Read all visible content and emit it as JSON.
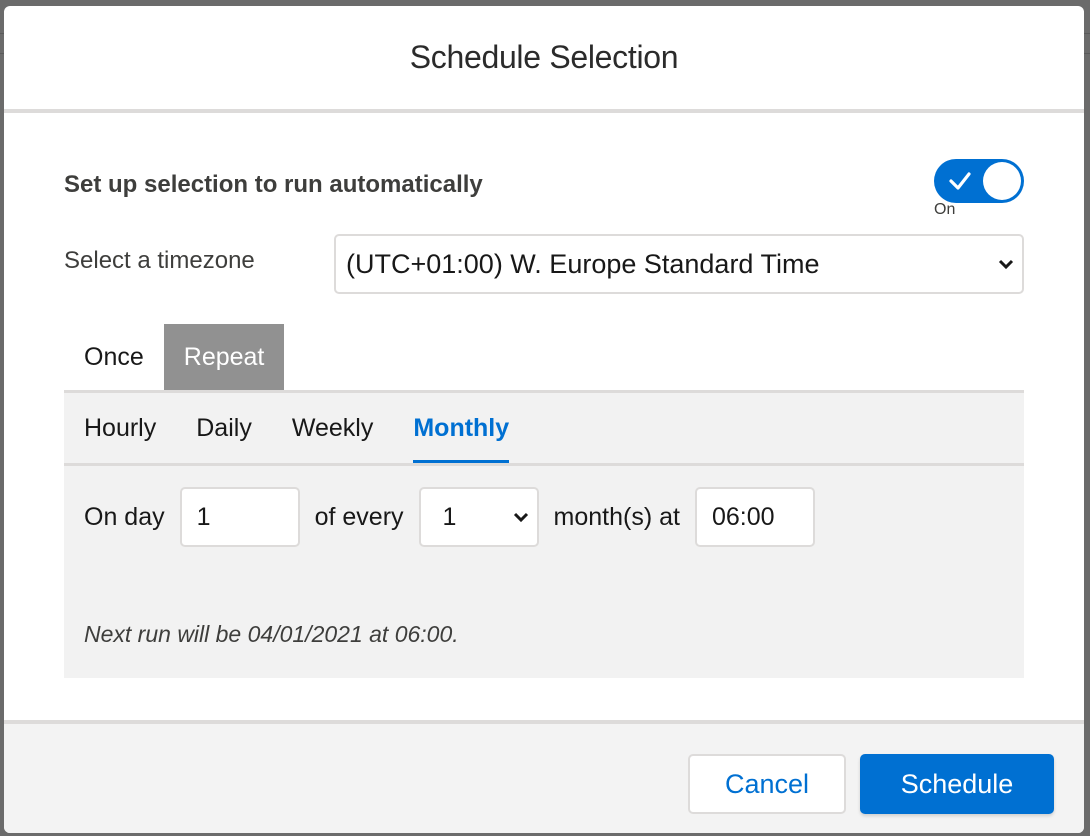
{
  "modal": {
    "title": "Schedule Selection"
  },
  "automation": {
    "heading": "Set up selection to run automatically",
    "toggle_state_label": "On",
    "toggle_on": true,
    "accent_color": "#0070d2"
  },
  "timezone": {
    "label": "Select a timezone",
    "selected": "(UTC+01:00) W. Europe Standard Time"
  },
  "frequency_tabs": [
    {
      "label": "Once",
      "active": false
    },
    {
      "label": "Repeat",
      "active": true
    }
  ],
  "repeat_tabs": [
    {
      "label": "Hourly",
      "active": false
    },
    {
      "label": "Daily",
      "active": false
    },
    {
      "label": "Weekly",
      "active": false
    },
    {
      "label": "Monthly",
      "active": true
    }
  ],
  "monthly": {
    "on_day_label": "On day",
    "day_value": "1",
    "of_every_label": "of every",
    "interval_selected": "1",
    "months_at_label": "month(s) at",
    "time_value": "06:00"
  },
  "next_run_text": "Next run will be 04/01/2021 at 06:00.",
  "footer": {
    "cancel_label": "Cancel",
    "schedule_label": "Schedule"
  }
}
